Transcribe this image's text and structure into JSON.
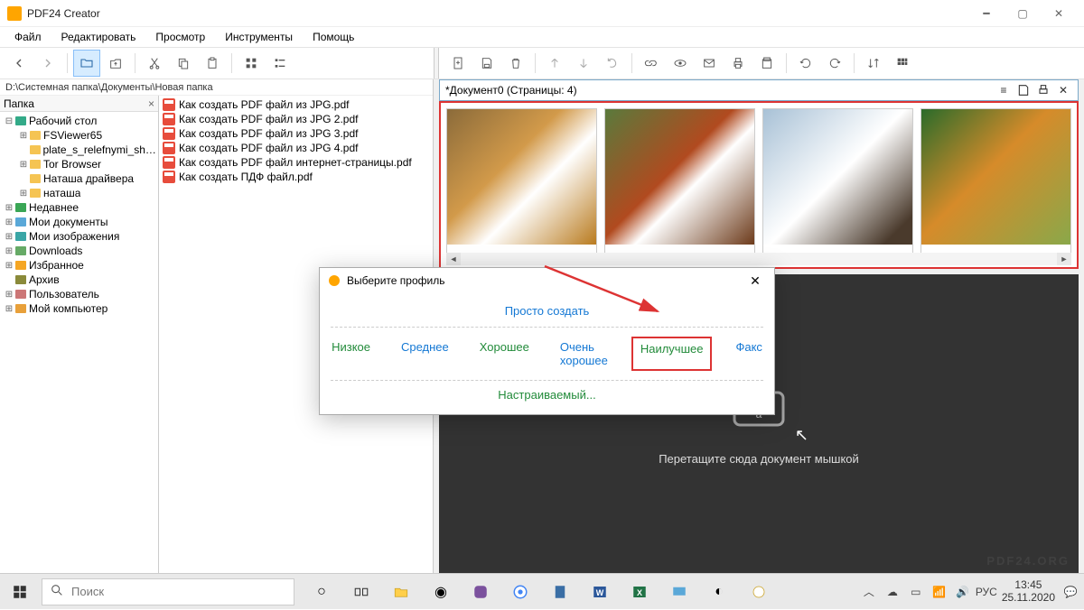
{
  "window": {
    "title": "PDF24 Creator"
  },
  "menu": {
    "file": "Файл",
    "edit": "Редактировать",
    "view": "Просмотр",
    "tools": "Инструменты",
    "help": "Помощь"
  },
  "path": "D:\\Системная папка\\Документы\\Новая папка",
  "treeHeader": "Папка",
  "tree": [
    {
      "label": "Рабочий стол",
      "indent": 0,
      "exp": "−",
      "icon": "desktop"
    },
    {
      "label": "FSViewer65",
      "indent": 1,
      "exp": "+",
      "icon": "folder"
    },
    {
      "label": "plate_s_relefnymi_shvar",
      "indent": 1,
      "exp": "",
      "icon": "folder"
    },
    {
      "label": "Tor Browser",
      "indent": 1,
      "exp": "+",
      "icon": "folder"
    },
    {
      "label": "Наташа драйвера",
      "indent": 1,
      "exp": "",
      "icon": "folder"
    },
    {
      "label": "наташа",
      "indent": 1,
      "exp": "+",
      "icon": "folder"
    },
    {
      "label": "Недавнее",
      "indent": 0,
      "exp": "+",
      "icon": "recent"
    },
    {
      "label": "Мои документы",
      "indent": 0,
      "exp": "+",
      "icon": "docs"
    },
    {
      "label": "Мои изображения",
      "indent": 0,
      "exp": "+",
      "icon": "pics"
    },
    {
      "label": "Downloads",
      "indent": 0,
      "exp": "+",
      "icon": "down"
    },
    {
      "label": "Избранное",
      "indent": 0,
      "exp": "+",
      "icon": "fav"
    },
    {
      "label": "Архив",
      "indent": 0,
      "exp": "",
      "icon": "archive"
    },
    {
      "label": "Пользователь",
      "indent": 0,
      "exp": "+",
      "icon": "user"
    },
    {
      "label": "Мой компьютер",
      "indent": 0,
      "exp": "+",
      "icon": "pc"
    }
  ],
  "files": [
    "Как создать PDF файл из JPG.pdf",
    "Как создать PDF файл из JPG 2.pdf",
    "Как создать PDF файл из JPG 3.pdf",
    "Как создать PDF файл из JPG 4.pdf",
    "Как создать PDF файл интернет-страницы.pdf",
    "Как создать ПДФ файл.pdf"
  ],
  "doc": {
    "title": "*Документ0 (Страницы: 4)"
  },
  "drop": {
    "hint": "Перетащите сюда документ мышкой"
  },
  "watermark": "PDF24.ORG",
  "dialog": {
    "title": "Выберите профиль",
    "create": "Просто создать",
    "custom": "Настраиваемый...",
    "opts": {
      "low": "Низкое",
      "mid": "Среднее",
      "good": "Хорошее",
      "vgood": "Очень хорошее",
      "best": "Наилучшее",
      "fax": "Факс"
    }
  },
  "search": {
    "placeholder": "Поиск"
  },
  "tray": {
    "lang": "РУС",
    "time": "13:45",
    "date": "25.11.2020"
  }
}
